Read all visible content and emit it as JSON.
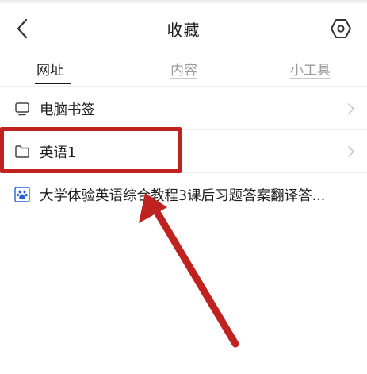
{
  "header": {
    "title": "收藏",
    "back_icon": "chevron-left-icon",
    "settings_icon": "hexagon-settings-icon"
  },
  "tabs": [
    {
      "label": "网址",
      "active": true
    },
    {
      "label": "内容",
      "active": false
    },
    {
      "label": "小工具",
      "active": false
    }
  ],
  "list": {
    "items": [
      {
        "label": "电脑书签",
        "icon": "monitor-icon",
        "has_chevron": true
      },
      {
        "label": "英语1",
        "icon": "folder-icon",
        "has_chevron": true
      },
      {
        "label": "大学体验英语综合教程3课后习题答案翻译答...",
        "icon": "baidu-paw-icon",
        "has_chevron": false
      }
    ]
  },
  "annotation": {
    "color": "#c0221f"
  }
}
